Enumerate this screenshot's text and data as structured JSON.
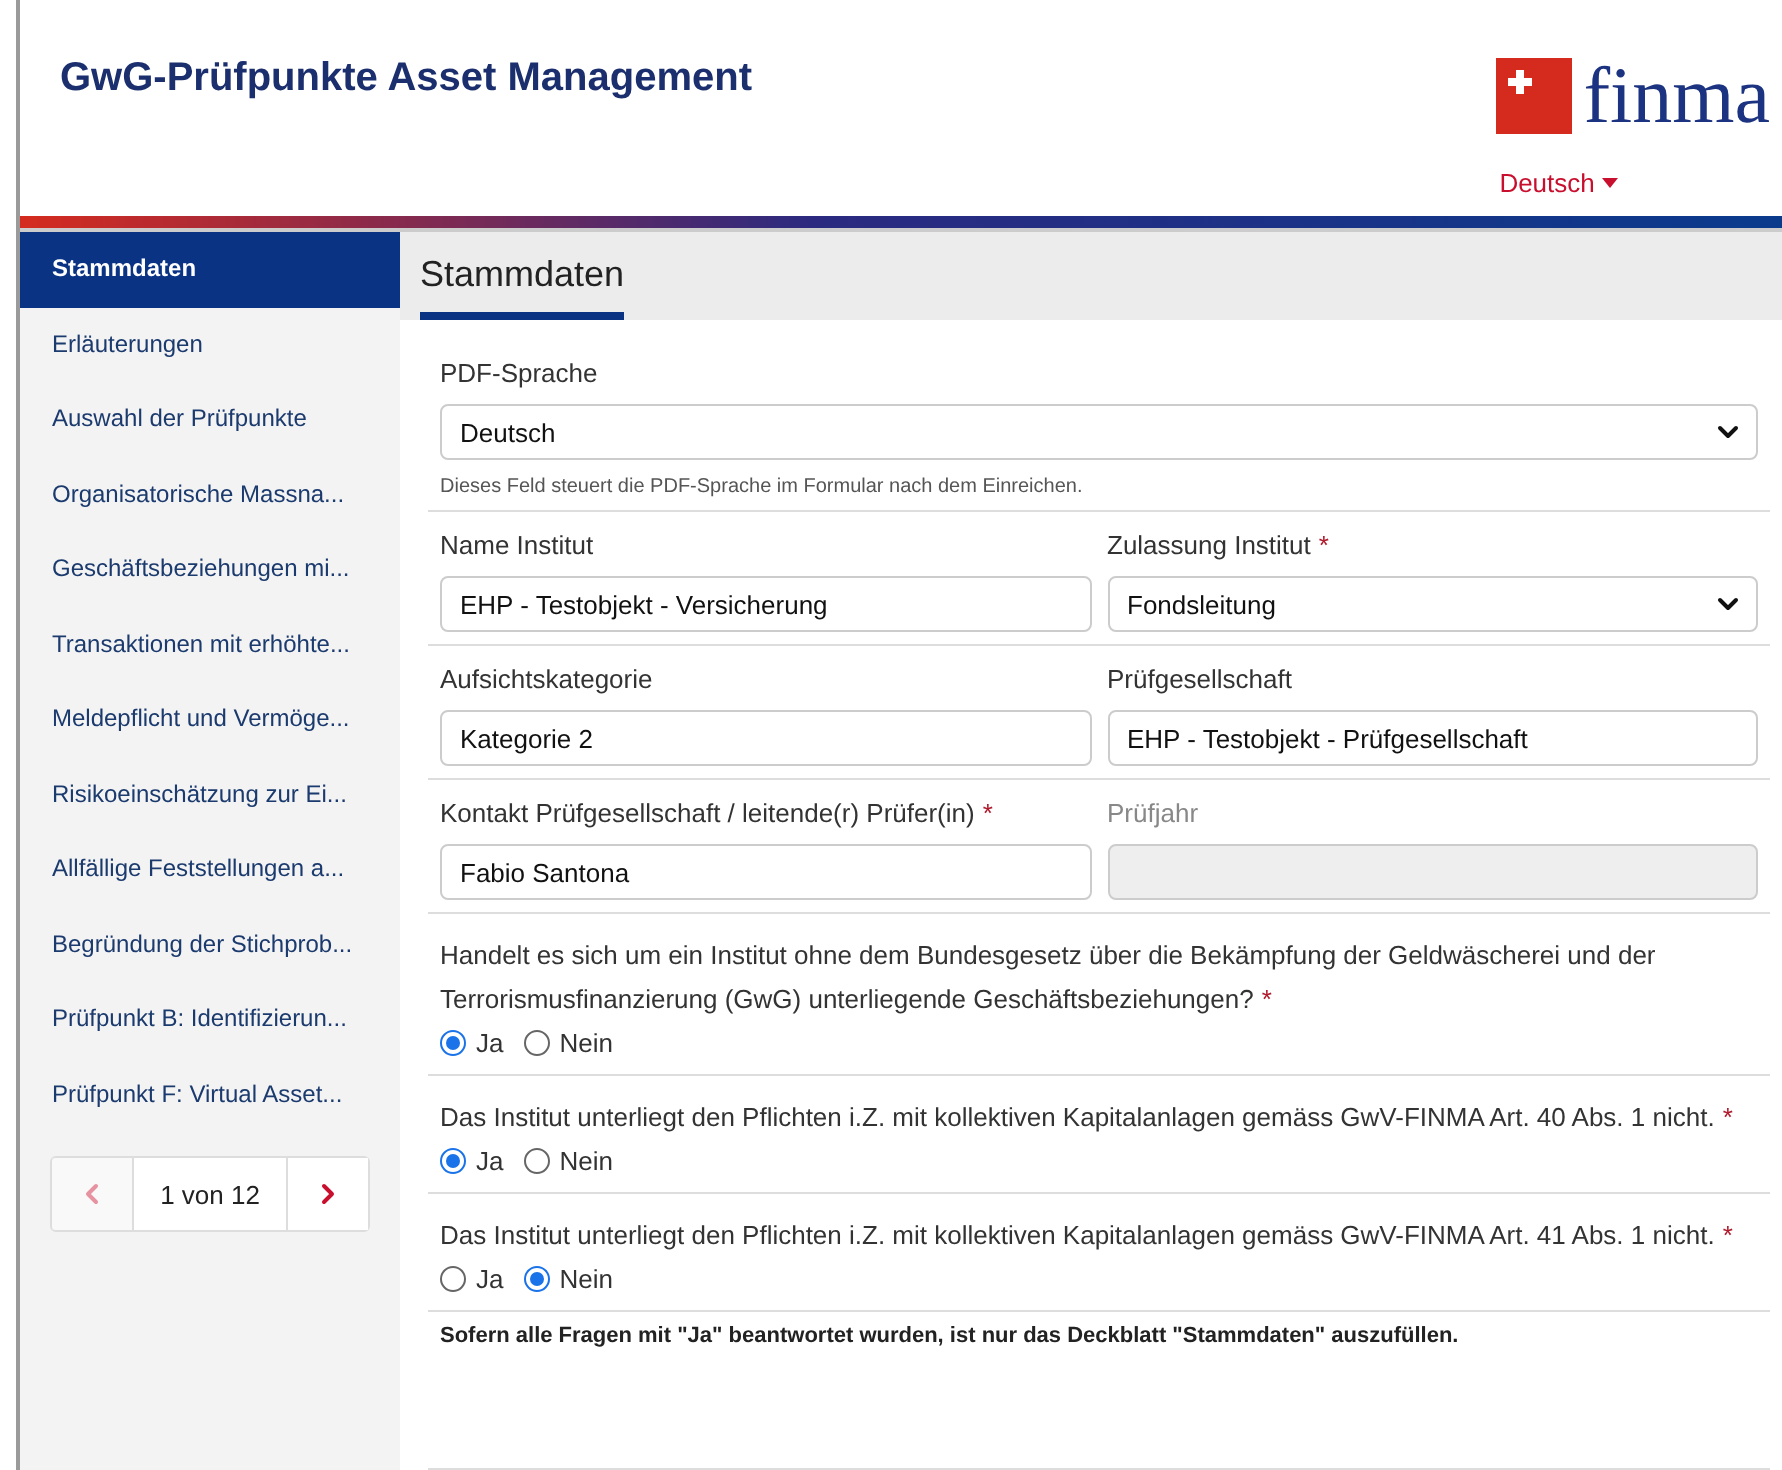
{
  "header": {
    "title": "GwG-Prüfpunkte Asset Management",
    "logo_text": "finma",
    "language": "Deutsch"
  },
  "sidebar": {
    "items": [
      {
        "label": "Stammdaten",
        "selected": true
      },
      {
        "label": "Erläuterungen",
        "selected": false
      },
      {
        "label": "Auswahl der Prüfpunkte",
        "selected": false
      },
      {
        "label": "Organisatorische Massna...",
        "selected": false
      },
      {
        "label": "Geschäftsbeziehungen mi...",
        "selected": false
      },
      {
        "label": "Transaktionen mit erhöhte...",
        "selected": false
      },
      {
        "label": "Meldepflicht und Vermöge...",
        "selected": false
      },
      {
        "label": "Risikoeinschätzung zur Ei...",
        "selected": false
      },
      {
        "label": "Allfällige Feststellungen a...",
        "selected": false
      },
      {
        "label": "Begründung der Stichprob...",
        "selected": false
      },
      {
        "label": "Prüfpunkt B: Identifizierun...",
        "selected": false
      },
      {
        "label": "Prüfpunkt F: Virtual Asset...",
        "selected": false
      }
    ],
    "pager": {
      "text": "1 von 12",
      "prev_disabled": true,
      "next_disabled": false
    }
  },
  "section_title": "Stammdaten",
  "pdf_language": {
    "label": "PDF-Sprache",
    "value": "Deutsch",
    "hint": "Dieses Feld steuert die PDF-Sprache im Formular nach dem Einreichen."
  },
  "field_rows": [
    [
      {
        "kind": "input",
        "label": "Name Institut",
        "value": "EHP - Testobjekt - Versicherung",
        "disabled": false
      },
      {
        "kind": "select",
        "label": "Zulassung Institut",
        "required_mark": "*",
        "value": "Fondsleitung",
        "disabled": false
      }
    ],
    [
      {
        "kind": "input",
        "label": "Aufsichtskategorie",
        "value": "Kategorie 2",
        "disabled": false
      },
      {
        "kind": "input",
        "label": "Prüfgesellschaft",
        "value": "EHP - Testobjekt - Prüfgesellschaft",
        "disabled": false
      }
    ],
    [
      {
        "kind": "input",
        "label": "Kontakt Prüfgesellschaft / leitende(r) Prüfer(in)",
        "required_mark": "*",
        "value": "Fabio Santona",
        "disabled": false
      },
      {
        "kind": "input",
        "label": "Prüfjahr",
        "disabled": true
      }
    ]
  ],
  "questions": [
    {
      "text": "Handelt es sich um ein Institut ohne dem Bundesgesetz über die Bekämpfung der Geldwäscherei und der Terrorismusfinanzierung (GwG) unterliegende Geschäftsbeziehungen?",
      "required_mark": "*",
      "options": [
        {
          "label": "Ja",
          "selected": true
        },
        {
          "label": "Nein",
          "selected": false
        }
      ]
    },
    {
      "text": "Das Institut unterliegt den Pflichten i.Z. mit kollektiven Kapitalanlagen gemäss GwV-FINMA Art. 40 Abs. 1 nicht.",
      "required_mark": "*",
      "options": [
        {
          "label": "Ja",
          "selected": true
        },
        {
          "label": "Nein",
          "selected": false
        }
      ]
    },
    {
      "text": "Das Institut unterliegt den Pflichten i.Z. mit kollektiven Kapitalanlagen gemäss GwV-FINMA Art. 41 Abs. 1 nicht.",
      "required_mark": "*",
      "options": [
        {
          "label": "Ja",
          "selected": false
        },
        {
          "label": "Nein",
          "selected": true
        }
      ]
    }
  ],
  "note": "Sofern alle Fragen mit \"Ja\" beantwortet wurden, ist nur das Deckblatt \"Stammdaten\" auszufüllen."
}
